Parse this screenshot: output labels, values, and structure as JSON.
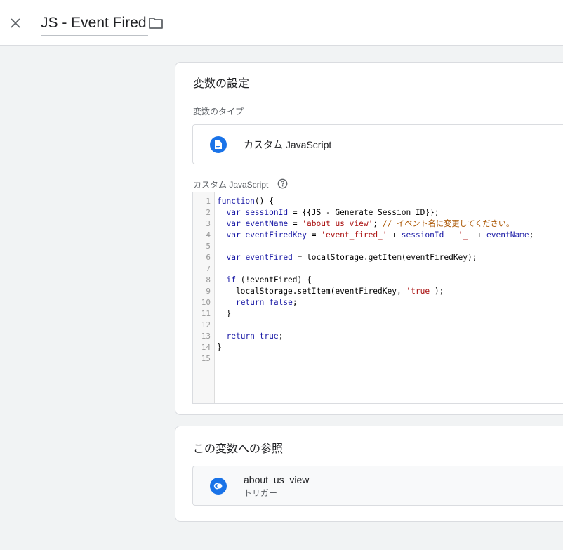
{
  "header": {
    "title": "JS - Event Fired",
    "close_icon": "close-icon",
    "folder_icon": "folder-icon"
  },
  "variable_config": {
    "section_title": "変数の設定",
    "type_label": "変数のタイプ",
    "type_value": "カスタム JavaScript",
    "type_icon": "document-icon",
    "code_label": "カスタム JavaScript",
    "help_icon": "help-circle-icon",
    "code_lines": [
      "function() {",
      "  var sessionId = {{JS - Generate Session ID}};",
      "  var eventName = 'about_us_view'; // イベント名に変更してください。",
      "  var eventFiredKey = 'event_fired_' + sessionId + '_' + eventName;",
      "",
      "  var eventFired = localStorage.getItem(eventFiredKey);",
      "",
      "  if (!eventFired) {",
      "    localStorage.setItem(eventFiredKey, 'true');",
      "    return false;",
      "  }",
      "",
      "  return true;",
      "}",
      ""
    ],
    "line_numbers": [
      "1",
      "2",
      "3",
      "4",
      "5",
      "6",
      "7",
      "8",
      "9",
      "10",
      "11",
      "12",
      "13",
      "14",
      "15"
    ]
  },
  "references": {
    "section_title": "この変数への参照",
    "items": [
      {
        "name": "about_us_view",
        "type": "トリガー",
        "icon": "trigger-icon"
      }
    ]
  },
  "colors": {
    "accent": "#1a73e8",
    "keyword": "#1a1aa6",
    "string": "#aa1111",
    "comment": "#aa5500"
  }
}
